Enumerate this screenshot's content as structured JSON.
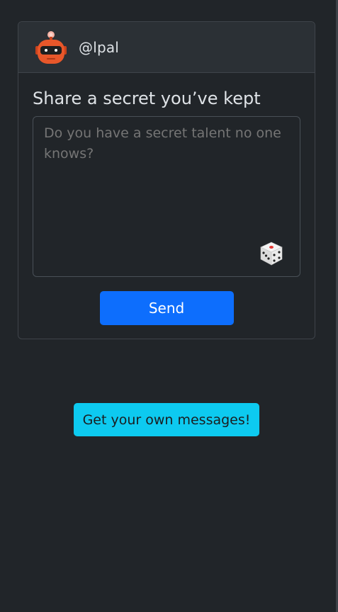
{
  "profile": {
    "username": "@lpal",
    "avatar_icon": "robot-icon"
  },
  "form": {
    "title": "Share a secret you’ve kept",
    "placeholder": "Do you have a secret talent no one knows?",
    "randomize_icon": "dice-icon",
    "send_label": "Send"
  },
  "footer": {
    "cta_label": "Get your own messages!"
  },
  "colors": {
    "background": "#212529",
    "header_bg": "#2b3035",
    "primary": "#0d6efd",
    "info": "#0dcaf0",
    "avatar": "#e8572a"
  }
}
